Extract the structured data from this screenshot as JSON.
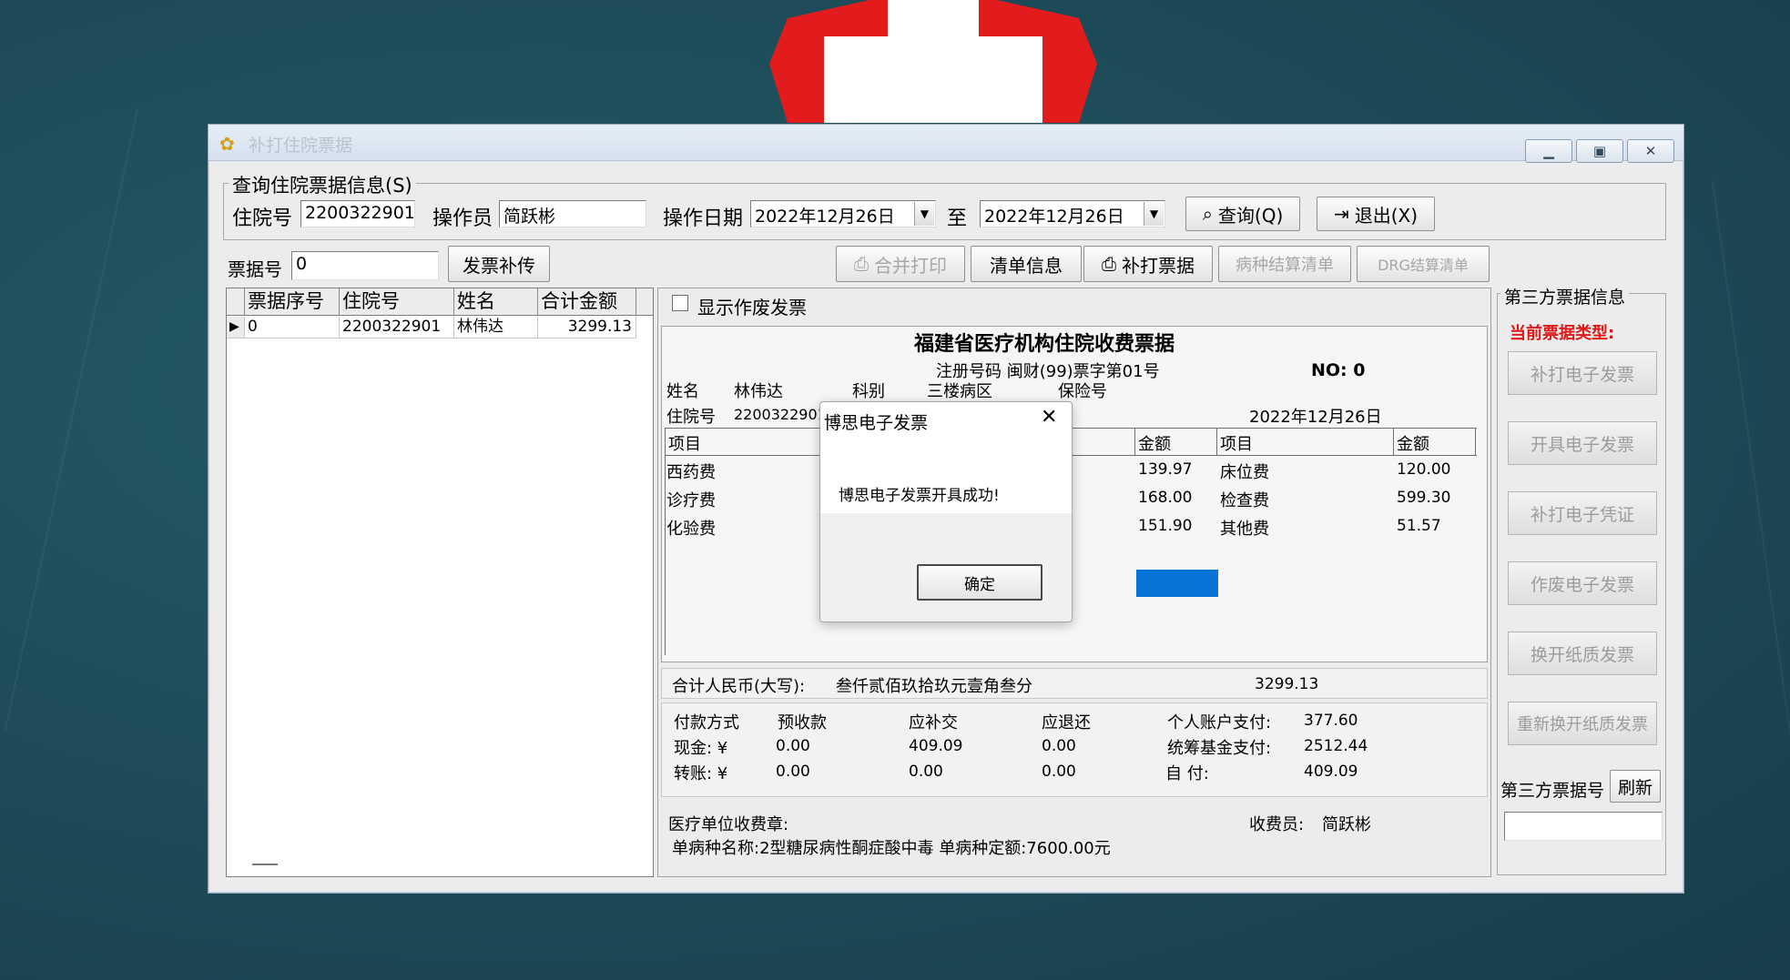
{
  "window": {
    "title": "补打住院票据",
    "min_icon": "minimize-icon",
    "max_icon": "maximize-icon",
    "close_icon": "close-icon"
  },
  "query": {
    "legend": "查询住院票据信息(S)",
    "admission_label": "住院号",
    "admission_value": "2200322901",
    "operator_label": "操作员",
    "operator_value": "简跃彬",
    "date_label": "操作日期",
    "date_from": "2022年12月26日",
    "date_sep": "至",
    "date_to": "2022年12月26日",
    "search_btn": "查询(Q)",
    "exit_btn": "退出(X)"
  },
  "toolbar": {
    "receipt_no_label": "票据号",
    "receipt_no_value": "0",
    "invoice_upload_btn": "发票补传",
    "merge_print_btn": "合并打印",
    "list_info_btn": "清单信息",
    "reprint_btn": "补打票据",
    "disease_settle_btn": "病种结算清单",
    "drg_settle_btn": "DRG结算清单"
  },
  "grid": {
    "headers": [
      "票据序号",
      "住院号",
      "姓名",
      "合计金额"
    ],
    "rows": [
      [
        "0",
        "2200322901",
        "林伟达",
        "3299.13"
      ]
    ]
  },
  "receipt": {
    "show_void_label": "显示作废发票",
    "title": "福建省医疗机构住院收费票据",
    "reg_no": "注册号码 闽财(99)票字第01号",
    "no_label": "NO: 0",
    "name_label": "姓名",
    "name_value": "林伟达",
    "dept_label": "科别",
    "dept_value": "三楼病区",
    "insurance_label": "保险号",
    "admission_label": "住院号",
    "admission_value": "2200322901",
    "date": "2022年12月26日",
    "col_item": "项目",
    "col_amount": "金额",
    "items_left": [
      {
        "name": "西药费",
        "amount": "139.97"
      },
      {
        "name": "诊疗费",
        "amount": "168.00"
      },
      {
        "name": "化验费",
        "amount": "151.90"
      }
    ],
    "items_right": [
      {
        "name": "床位费",
        "amount": "120.00"
      },
      {
        "name": "检查费",
        "amount": "599.30"
      },
      {
        "name": "其他费",
        "amount": "51.57"
      }
    ],
    "total_label": "合计人民币(大写):",
    "total_words": "叁仟贰佰玖拾玖元壹角叁分",
    "total_value": "3299.13",
    "pay_method": "付款方式",
    "prepaid": "预收款",
    "should_pay": "应补交",
    "should_refund": "应退还",
    "cash_label": "现金: ¥",
    "cash_prepaid": "0.00",
    "cash_pay": "409.09",
    "cash_refund": "0.00",
    "transfer_label": "转账: ¥",
    "transfer_prepaid": "0.00",
    "transfer_pay": "0.00",
    "transfer_refund": "0.00",
    "personal_label": "个人账户支付:",
    "personal_value": "377.60",
    "fund_label": "统筹基金支付:",
    "fund_value": "2512.44",
    "self_label": "自  付:",
    "self_value": "409.09",
    "stamp_label": "医疗单位收费章:",
    "cashier_label": "收费员:",
    "cashier_value": "简跃彬",
    "disease_line": "单病种名称:2型糖尿病性酮症酸中毒  单病种定额:7600.00元"
  },
  "side": {
    "legend": "第三方票据信息",
    "current_type_label": "当前票据类型:",
    "buttons": [
      "补打电子发票",
      "开具电子发票",
      "补打电子凭证",
      "作废电子发票",
      "换开纸质发票",
      "重新换开纸质发票"
    ],
    "third_party_no_label": "第三方票据号",
    "refresh_btn": "刷新"
  },
  "dialog": {
    "title": "博思电子发票",
    "message": "博思电子发票开具成功!",
    "ok_btn": "确定"
  },
  "colors": {
    "background": "#1d4a57",
    "accent_red": "#e21c1c",
    "progress_blue": "#0a74d6"
  }
}
